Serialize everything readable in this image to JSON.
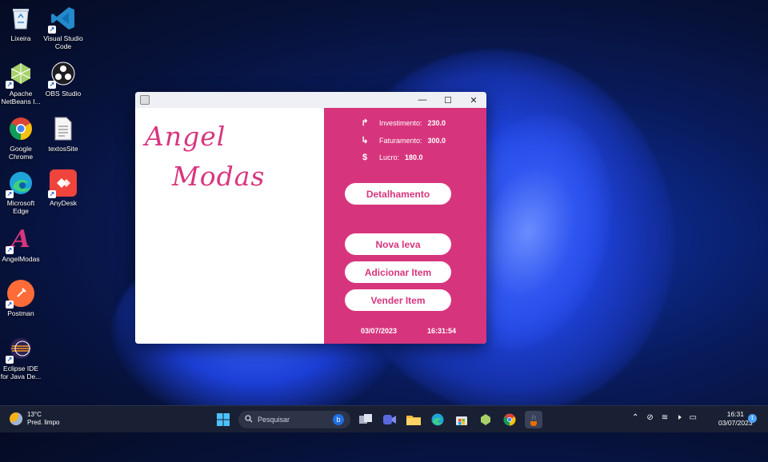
{
  "desktop": {
    "icons": [
      {
        "label": "Lixeira",
        "icon": "recycle-bin-icon"
      },
      {
        "label": "Visual Studio Code",
        "icon": "vscode-icon"
      },
      {
        "label": "Apache NetBeans I...",
        "icon": "netbeans-icon"
      },
      {
        "label": "OBS Studio",
        "icon": "obs-icon"
      },
      {
        "label": "Google Chrome",
        "icon": "chrome-icon"
      },
      {
        "label": "textosSite",
        "icon": "text-file-icon"
      },
      {
        "label": "Microsoft Edge",
        "icon": "edge-icon"
      },
      {
        "label": "AnyDesk",
        "icon": "anydesk-icon"
      },
      {
        "label": "AngelModas",
        "icon": "angelmodas-icon"
      },
      {
        "label": "Postman",
        "icon": "postman-icon"
      },
      {
        "label": "Eclipse IDE for Java De...",
        "icon": "eclipse-icon"
      }
    ]
  },
  "window": {
    "logo_line1": "Angel",
    "logo_line2": "Modas",
    "stats": {
      "investimento_label": "Investimento:",
      "investimento_value": "230.0",
      "faturamento_label": "Faturamento:",
      "faturamento_value": "300.0",
      "lucro_label": "Lucro:",
      "lucro_value": "180.0",
      "investimento_icon": "↱",
      "faturamento_icon": "↳",
      "lucro_icon": "$"
    },
    "buttons": {
      "detalhamento": "Detalhamento",
      "nova_leva": "Nova leva",
      "adicionar_item": "Adicionar Item",
      "vender_item": "Vender Item"
    },
    "footer": {
      "date": "03/07/2023",
      "time": "16:31:54"
    },
    "controls": {
      "minimize": "—",
      "maximize": "☐",
      "close": "✕"
    }
  },
  "taskbar": {
    "weather_temp": "13°C",
    "weather_desc": "Pred. limpo",
    "search_placeholder": "Pesquisar",
    "clock_time": "16:31",
    "clock_date": "03/07/2023",
    "notifications": "1"
  },
  "colors": {
    "accent": "#d6357d",
    "taskbar": "#1a2033"
  }
}
